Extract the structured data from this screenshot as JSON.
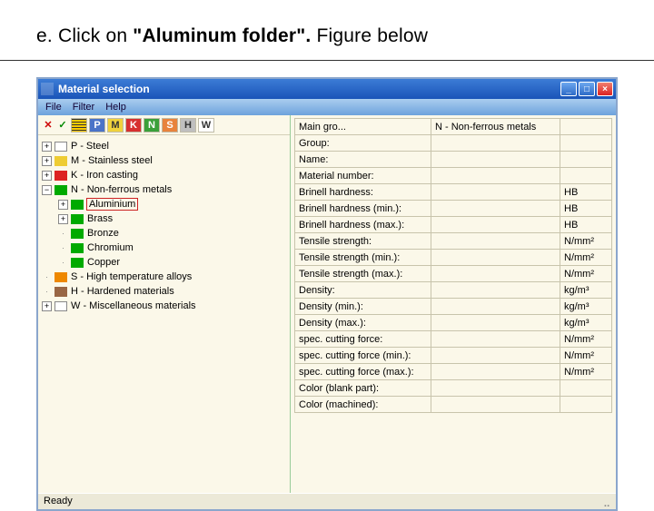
{
  "caption": {
    "prefix": "e. Click on ",
    "bold": "\"Aluminum folder\".",
    "suffix": " Figure below"
  },
  "window": {
    "title": "Material selection",
    "min": "_",
    "max": "□",
    "close": "×"
  },
  "menu": [
    "File",
    "Filter",
    "Help"
  ],
  "toolbar": {
    "cancel": "✕",
    "ok": "✓",
    "btns": [
      {
        "label": "P",
        "bg": "#4a73c8",
        "fg": "#fff"
      },
      {
        "label": "M",
        "bg": "#f0d23c",
        "fg": "#333"
      },
      {
        "label": "K",
        "bg": "#d73030",
        "fg": "#fff"
      },
      {
        "label": "N",
        "bg": "#3aa03a",
        "fg": "#fff"
      },
      {
        "label": "S",
        "bg": "#e8833c",
        "fg": "#fff"
      },
      {
        "label": "H",
        "bg": "#bfbfbf",
        "fg": "#333"
      },
      {
        "label": "W",
        "bg": "#ffffff",
        "fg": "#333"
      }
    ],
    "striped": "≡"
  },
  "tree": {
    "items": [
      {
        "exp": "+",
        "color": "",
        "label": "P - Steel"
      },
      {
        "exp": "+",
        "color": "yellow",
        "label": "M - Stainless steel"
      },
      {
        "exp": "+",
        "color": "red",
        "label": "K - Iron casting"
      },
      {
        "exp": "−",
        "color": "green",
        "label": "N - Non-ferrous metals"
      }
    ],
    "children": [
      {
        "exp": "+",
        "color": "green",
        "label": "Aluminium",
        "selected": true
      },
      {
        "exp": "+",
        "color": "green",
        "label": "Brass"
      },
      {
        "exp": "",
        "color": "green",
        "label": "Bronze"
      },
      {
        "exp": "",
        "color": "green",
        "label": "Chromium"
      },
      {
        "exp": "",
        "color": "green",
        "label": "Copper"
      }
    ],
    "after": [
      {
        "exp": "",
        "color": "orange",
        "label": "S - High temperature alloys"
      },
      {
        "exp": "",
        "color": "brown",
        "label": "H - Hardened materials"
      },
      {
        "exp": "+",
        "color": "white",
        "label": "W - Miscellaneous materials"
      }
    ]
  },
  "props": [
    {
      "label": "Main gro...",
      "value": "N - Non-ferrous metals",
      "unit": ""
    },
    {
      "label": "Group:",
      "value": "",
      "unit": ""
    },
    {
      "label": "Name:",
      "value": "",
      "unit": ""
    },
    {
      "label": "Material number:",
      "value": "",
      "unit": ""
    },
    {
      "label": "Brinell hardness:",
      "value": "",
      "unit": "HB"
    },
    {
      "label": "Brinell hardness (min.):",
      "value": "",
      "unit": "HB"
    },
    {
      "label": "Brinell hardness (max.):",
      "value": "",
      "unit": "HB"
    },
    {
      "label": "Tensile strength:",
      "value": "",
      "unit": "N/mm²"
    },
    {
      "label": "Tensile strength (min.):",
      "value": "",
      "unit": "N/mm²"
    },
    {
      "label": "Tensile strength (max.):",
      "value": "",
      "unit": "N/mm²"
    },
    {
      "label": "Density:",
      "value": "",
      "unit": "kg/m³"
    },
    {
      "label": "Density (min.):",
      "value": "",
      "unit": "kg/m³"
    },
    {
      "label": "Density (max.):",
      "value": "",
      "unit": "kg/m³"
    },
    {
      "label": "spec. cutting force:",
      "value": "",
      "unit": "N/mm²"
    },
    {
      "label": "spec. cutting force (min.):",
      "value": "",
      "unit": "N/mm²"
    },
    {
      "label": "spec. cutting force (max.):",
      "value": "",
      "unit": "N/mm²"
    },
    {
      "label": "Color (blank part):",
      "value": "",
      "unit": ""
    },
    {
      "label": "Color (machined):",
      "value": "",
      "unit": ""
    }
  ],
  "status": "Ready"
}
